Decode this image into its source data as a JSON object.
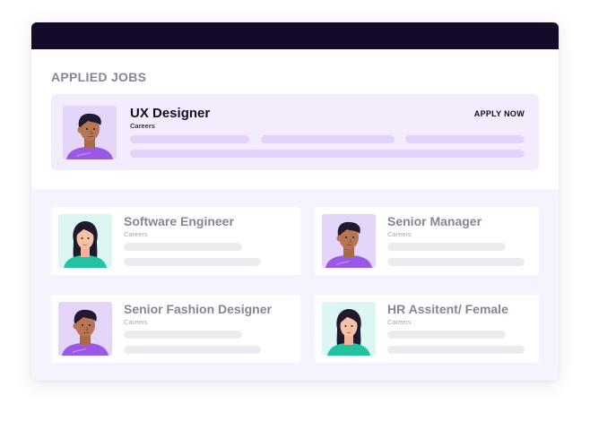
{
  "section_title": "APPLIED JOBS",
  "featured": {
    "title": "UX Designer",
    "category": "Careers",
    "action": "APPLY NOW"
  },
  "jobs": [
    {
      "title": "Software Engineer",
      "category": "Careers",
      "avatar": "female-avatar"
    },
    {
      "title": "Senior Manager",
      "category": "Careers",
      "avatar": "male-avatar"
    },
    {
      "title": "Senior Fashion Designer",
      "category": "Careers",
      "avatar": "male-avatar"
    },
    {
      "title": "HR Assitent/ Female",
      "category": "Careers",
      "avatar": "female-avatar"
    }
  ],
  "colors": {
    "topbar": "#140b2a",
    "featured_bg": "#f3ecfd",
    "lower_bg": "#f7f3fe",
    "accent_purple": "#9a57e8",
    "accent_teal": "#22c3a0"
  }
}
